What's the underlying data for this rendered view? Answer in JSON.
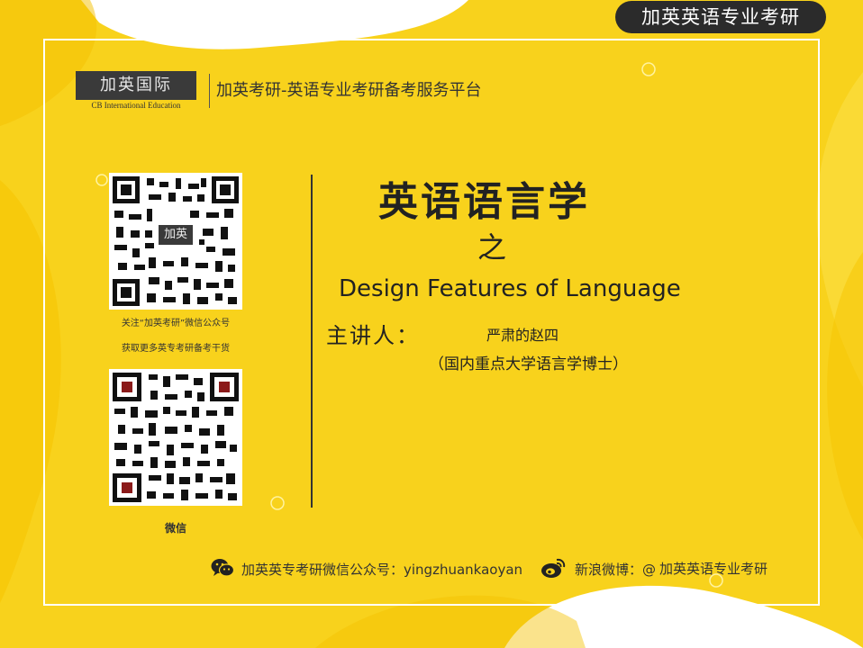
{
  "header": {
    "badge": "加英英语专业考研",
    "logo_text": "加英国际",
    "logo_subtitle": "CB International Education",
    "platform": "加英考研-英语专业考研备考服务平台"
  },
  "qr": {
    "logo_text": "加英",
    "caption_line1": "关注“加英考研”微信公众号",
    "caption_line2": "获取更多英专考研备考干货",
    "wechat_label": "微信"
  },
  "main": {
    "title": "英语语言学",
    "connector": "之",
    "topic": "Design Features of Language",
    "speaker_label": "主讲人：",
    "speaker_name": "严肃的赵四",
    "speaker_title": "（国内重点大学语言学博士）"
  },
  "footer": {
    "wechat_text": "加英英专考研微信公众号：yingzhuankaoyan",
    "weibo_label": "新浪微博：@",
    "weibo_name": "加英英语专业考研"
  },
  "icons": {
    "wechat": "wechat-icon",
    "weibo": "weibo-icon"
  },
  "colors": {
    "background": "#f8d21c",
    "badge": "#2b2b2b",
    "text": "#222222"
  }
}
